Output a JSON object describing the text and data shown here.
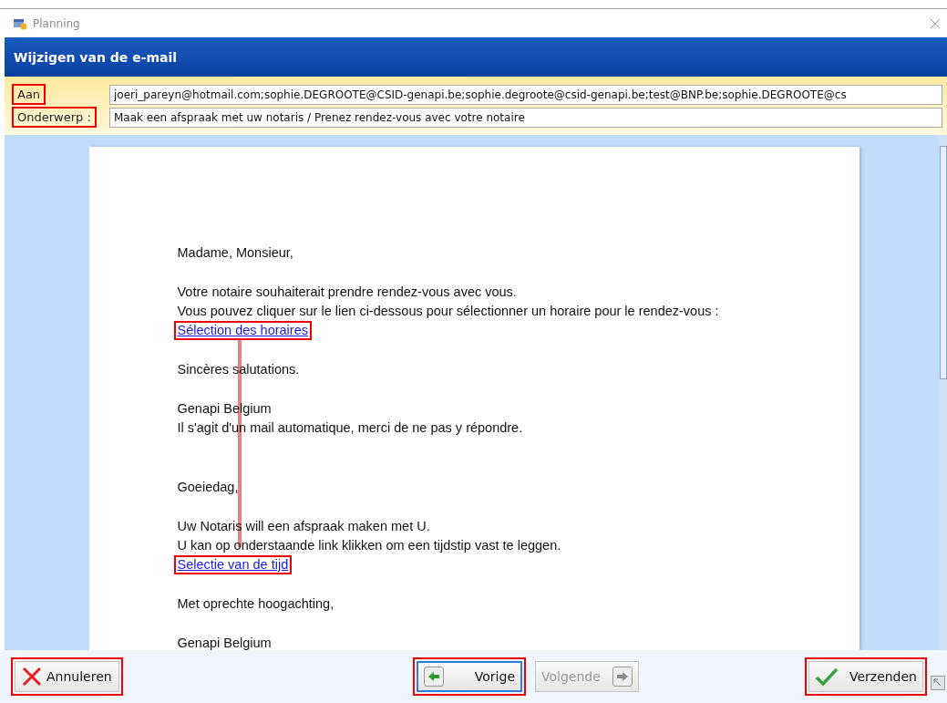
{
  "window": {
    "title": "Planning"
  },
  "header": {
    "title": "Wijzigen van de e-mail"
  },
  "fields": [
    {
      "label": "Aan",
      "value": "joeri_pareyn@hotmail.com;sophie.DEGROOTE@CSID-genapi.be;sophie.degroote@csid-genapi.be;test@BNP.be;sophie.DEGROOTE@cs",
      "highlighted": true
    },
    {
      "label": "Onderwerp :",
      "value": "Maak een afspraak met uw notaris / Prenez rendez-vous avec votre notaire",
      "highlighted": true
    }
  ],
  "letters": [
    {
      "paragraphs": [
        [
          {
            "kind": "text",
            "text": "Madame, Monsieur,"
          }
        ],
        [
          {
            "kind": "text",
            "text": "Votre notaire souhaiterait prendre rendez-vous avec vous."
          },
          {
            "kind": "text",
            "text": "Vous pouvez cliquer sur le lien ci-dessous pour sélectionner un horaire pour le rendez-vous :"
          },
          {
            "kind": "link",
            "text": "Sélection des horaires",
            "highlighted": true
          }
        ],
        [
          {
            "kind": "text",
            "text": "Sincères salutations."
          }
        ],
        [
          {
            "kind": "text",
            "text": "Genapi Belgium"
          },
          {
            "kind": "text",
            "text": "Il s'agit d'un mail automatique, merci de ne pas y répondre."
          }
        ]
      ]
    },
    {
      "paragraphs": [
        [
          {
            "kind": "text",
            "text": "Goeiedag,"
          }
        ],
        [
          {
            "kind": "text",
            "text": "Uw Notaris will een afspraak maken met U."
          },
          {
            "kind": "text",
            "text": "U kan op onderstaande link klikken om een tijdstip vast te leggen."
          },
          {
            "kind": "link",
            "text": "Selectie van de tijd",
            "highlighted": true
          }
        ],
        [
          {
            "kind": "text",
            "text": "Met oprechte hoogachting,"
          }
        ],
        [
          {
            "kind": "text",
            "text": "Genapi Belgium"
          }
        ]
      ]
    }
  ],
  "connector": {
    "shown": true
  },
  "buttons": [
    {
      "kind": "cancel",
      "label": "Annuleren",
      "disabled": false,
      "highlighted": true,
      "focused": false
    },
    {
      "kind": "prev",
      "label": "Vorige",
      "disabled": false,
      "highlighted": true,
      "focused": true
    },
    {
      "kind": "next",
      "label": "Volgende",
      "disabled": true,
      "highlighted": false,
      "focused": false
    },
    {
      "kind": "send",
      "label": "Verzenden",
      "disabled": false,
      "highlighted": true,
      "focused": false
    }
  ]
}
